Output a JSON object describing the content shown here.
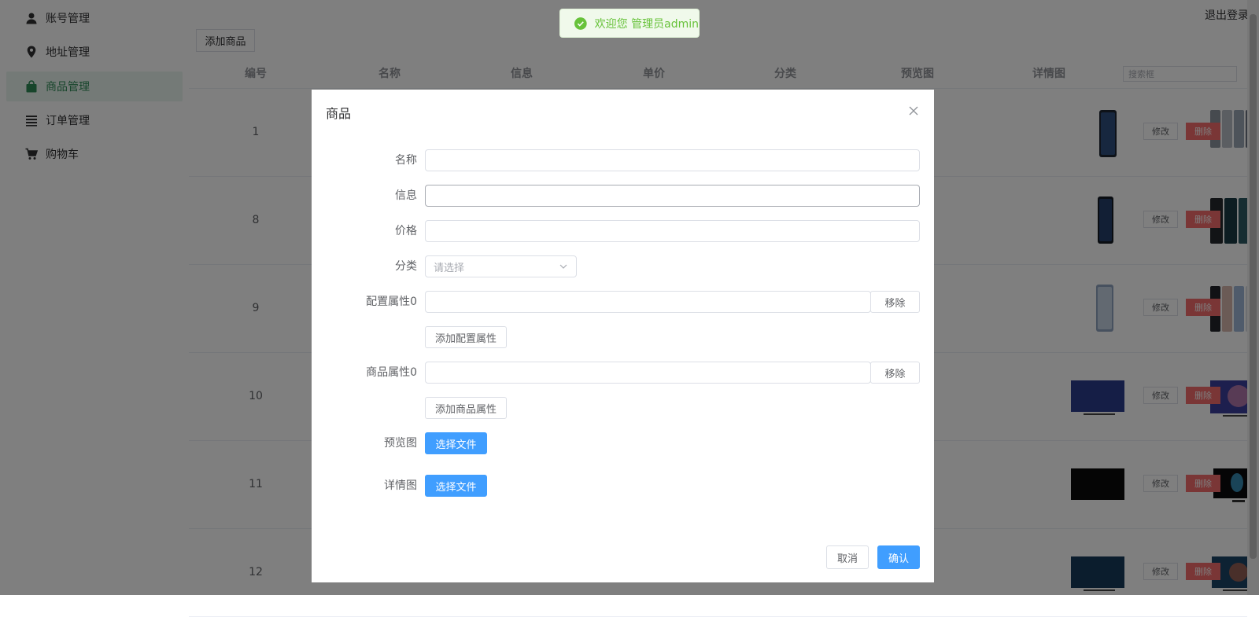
{
  "sidebar": {
    "items": [
      {
        "label": "账号管理",
        "icon": "user-icon",
        "active": false
      },
      {
        "label": "地址管理",
        "icon": "location-pin-icon",
        "active": false
      },
      {
        "label": "商品管理",
        "icon": "shopping-bag-icon",
        "active": true
      },
      {
        "label": "订单管理",
        "icon": "list-icon",
        "active": false
      },
      {
        "label": "购物车",
        "icon": "cart-icon",
        "active": false
      }
    ]
  },
  "header": {
    "logout_label": "退出登录",
    "add_product_label": "添加商品"
  },
  "table": {
    "columns": [
      "编号",
      "名称",
      "信息",
      "单价",
      "分类",
      "预览图",
      "详情图"
    ],
    "search_placeholder": "搜索框",
    "edit_label": "修改",
    "delete_label": "删除",
    "rows": [
      {
        "id": "1"
      },
      {
        "id": "8"
      },
      {
        "id": "9"
      },
      {
        "id": "10"
      },
      {
        "id": "11"
      },
      {
        "id": "12"
      }
    ]
  },
  "toast": {
    "message": "欢迎您 管理员admin",
    "color": "#67c23a"
  },
  "dialog": {
    "title": "商品",
    "fields": {
      "name_label": "名称",
      "info_label": "信息",
      "price_label": "价格",
      "category_label": "分类",
      "category_placeholder": "请选择",
      "config_attr_label": "配置属性0",
      "product_attr_label": "商品属性0",
      "preview_label": "预览图",
      "detail_label": "详情图"
    },
    "remove_label": "移除",
    "add_config_attr_label": "添加配置属性",
    "add_product_attr_label": "添加商品属性",
    "choose_file_label": "选择文件",
    "cancel_label": "取消",
    "confirm_label": "确认"
  },
  "colors": {
    "primary": "#409eff",
    "danger": "#f56c6c",
    "active_nav": "#2e8b57"
  }
}
